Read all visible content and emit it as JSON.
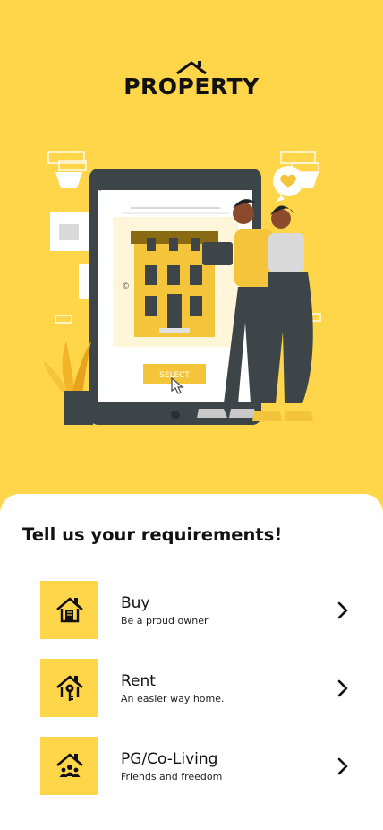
{
  "brand": {
    "name": "PROPERTY"
  },
  "illustration": {
    "button_text": "SELECT"
  },
  "sheet": {
    "title": "Tell us your requirements!",
    "options": [
      {
        "label": "Buy",
        "subtitle": "Be a proud owner",
        "icon": "house-document-icon"
      },
      {
        "label": "Rent",
        "subtitle": "An easier way home.",
        "icon": "house-key-icon"
      },
      {
        "label": "PG/Co-Living",
        "subtitle": "Friends and freedom",
        "icon": "house-people-icon"
      }
    ]
  },
  "colors": {
    "accent": "#FFD54A",
    "text": "#111111",
    "sheet": "#FFFFFF"
  }
}
